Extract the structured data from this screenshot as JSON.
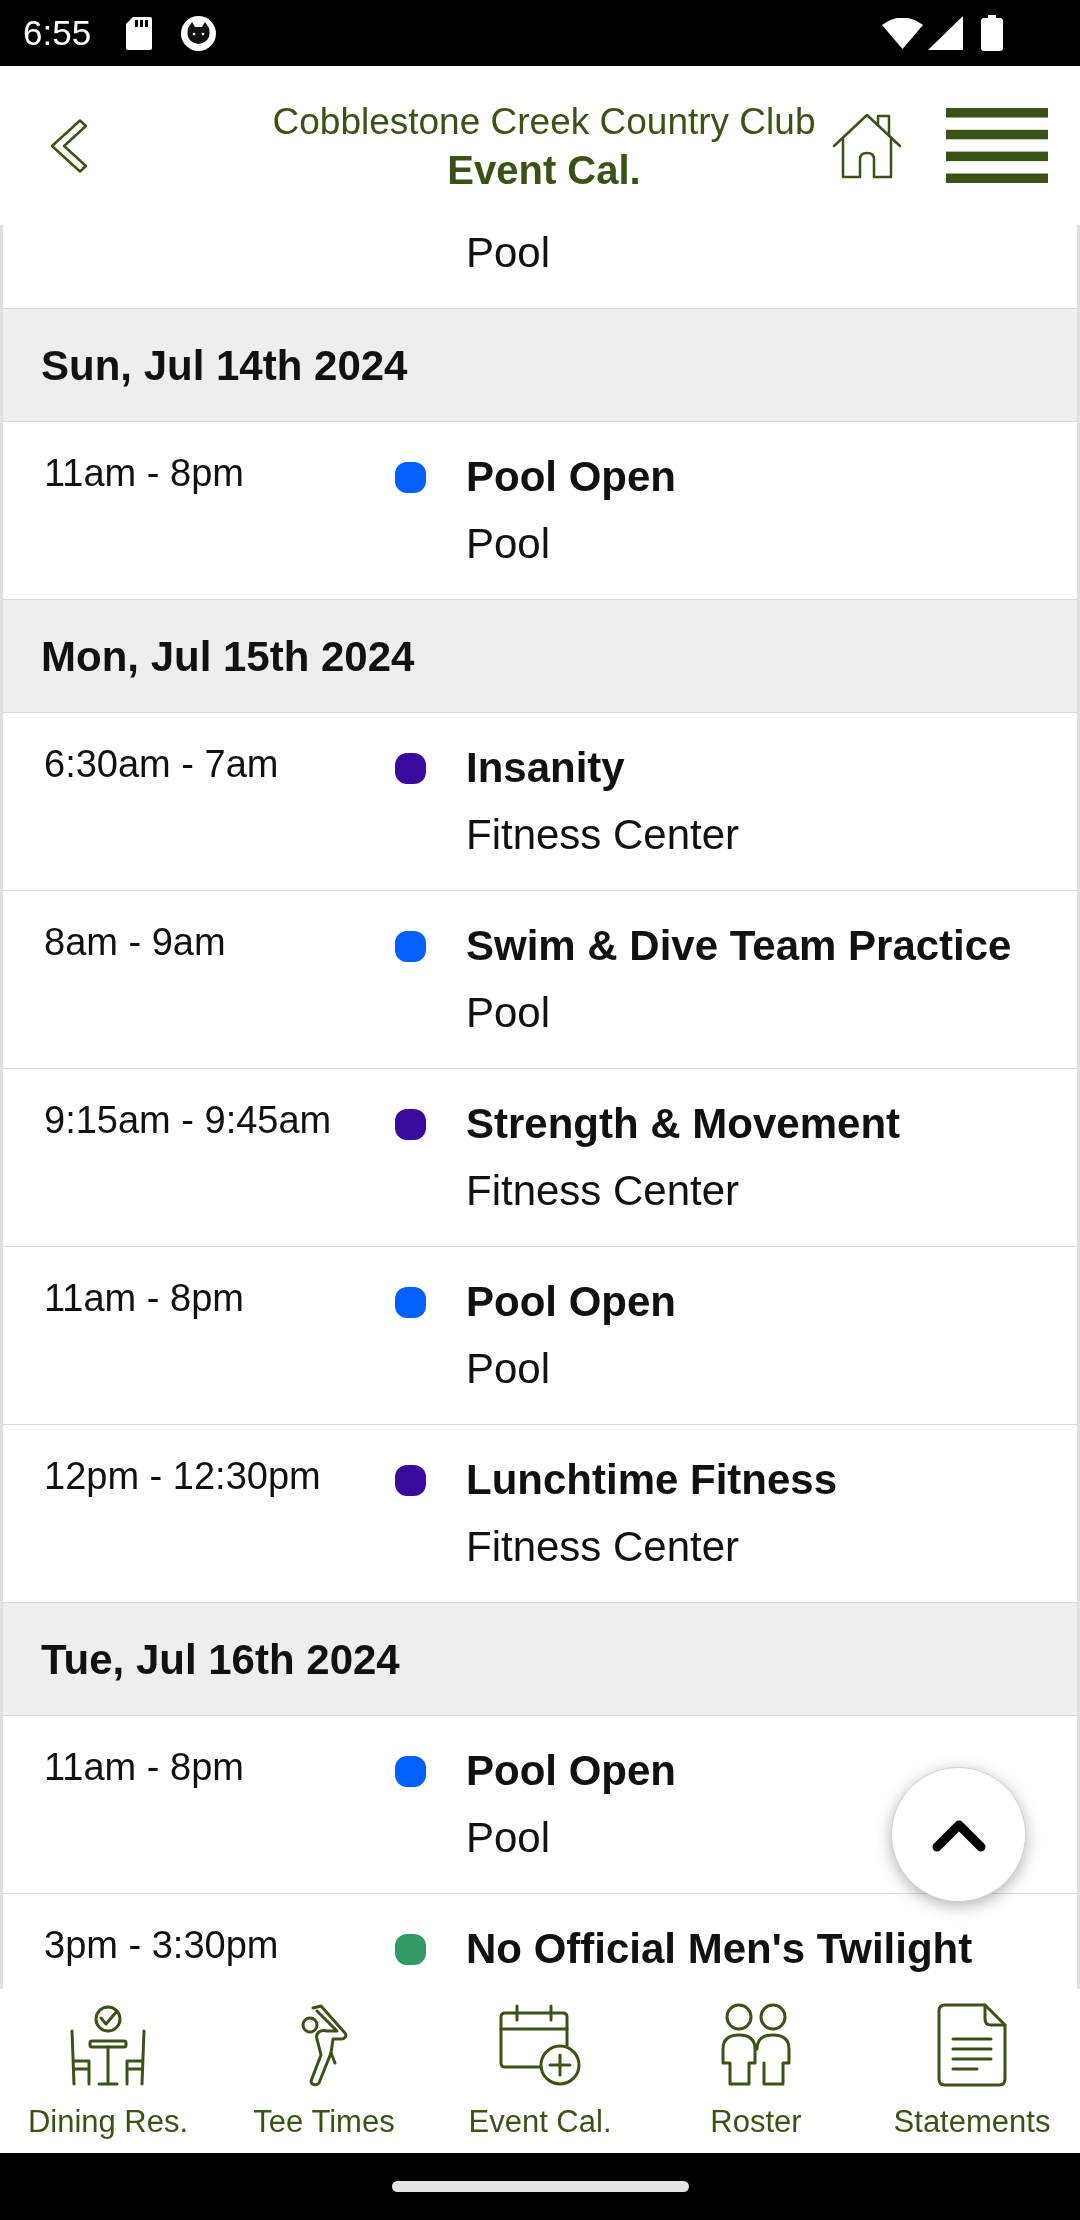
{
  "status_bar": {
    "time": "6:55"
  },
  "header": {
    "club_name": "Cobblestone Creek Country Club",
    "title": "Event Cal."
  },
  "days": [
    {
      "events": [
        {
          "location": "Pool"
        }
      ]
    },
    {
      "date": "Sun, Jul 14th 2024",
      "events": [
        {
          "time": "11am - 8pm",
          "color": "#0060ff",
          "title": "Pool Open",
          "location": "Pool"
        }
      ]
    },
    {
      "date": "Mon, Jul 15th 2024",
      "events": [
        {
          "time": "6:30am - 7am",
          "color": "#3a0a9e",
          "title": "Insanity",
          "location": "Fitness Center"
        },
        {
          "time": "8am - 9am",
          "color": "#0060ff",
          "title": "Swim & Dive Team Practice",
          "location": "Pool"
        },
        {
          "time": "9:15am - 9:45am",
          "color": "#3a0a9e",
          "title": "Strength & Movement",
          "location": "Fitness Center"
        },
        {
          "time": "11am - 8pm",
          "color": "#0060ff",
          "title": "Pool Open",
          "location": "Pool"
        },
        {
          "time": "12pm - 12:30pm",
          "color": "#3a0a9e",
          "title": "Lunchtime Fitness",
          "location": "Fitness Center"
        }
      ]
    },
    {
      "date": "Tue, Jul 16th 2024",
      "events": [
        {
          "time": "11am - 8pm",
          "color": "#0060ff",
          "title": "Pool Open",
          "location": "Pool"
        },
        {
          "time": "3pm - 3:30pm",
          "color": "#339966",
          "title": "No Official Men's Twilight"
        }
      ]
    }
  ],
  "bottom_nav": [
    {
      "kind": "dining",
      "label": "Dining Res."
    },
    {
      "kind": "golf",
      "label": "Tee Times"
    },
    {
      "kind": "calendar",
      "label": "Event Cal."
    },
    {
      "kind": "roster",
      "label": "Roster"
    },
    {
      "kind": "statements",
      "label": "Statements"
    }
  ]
}
